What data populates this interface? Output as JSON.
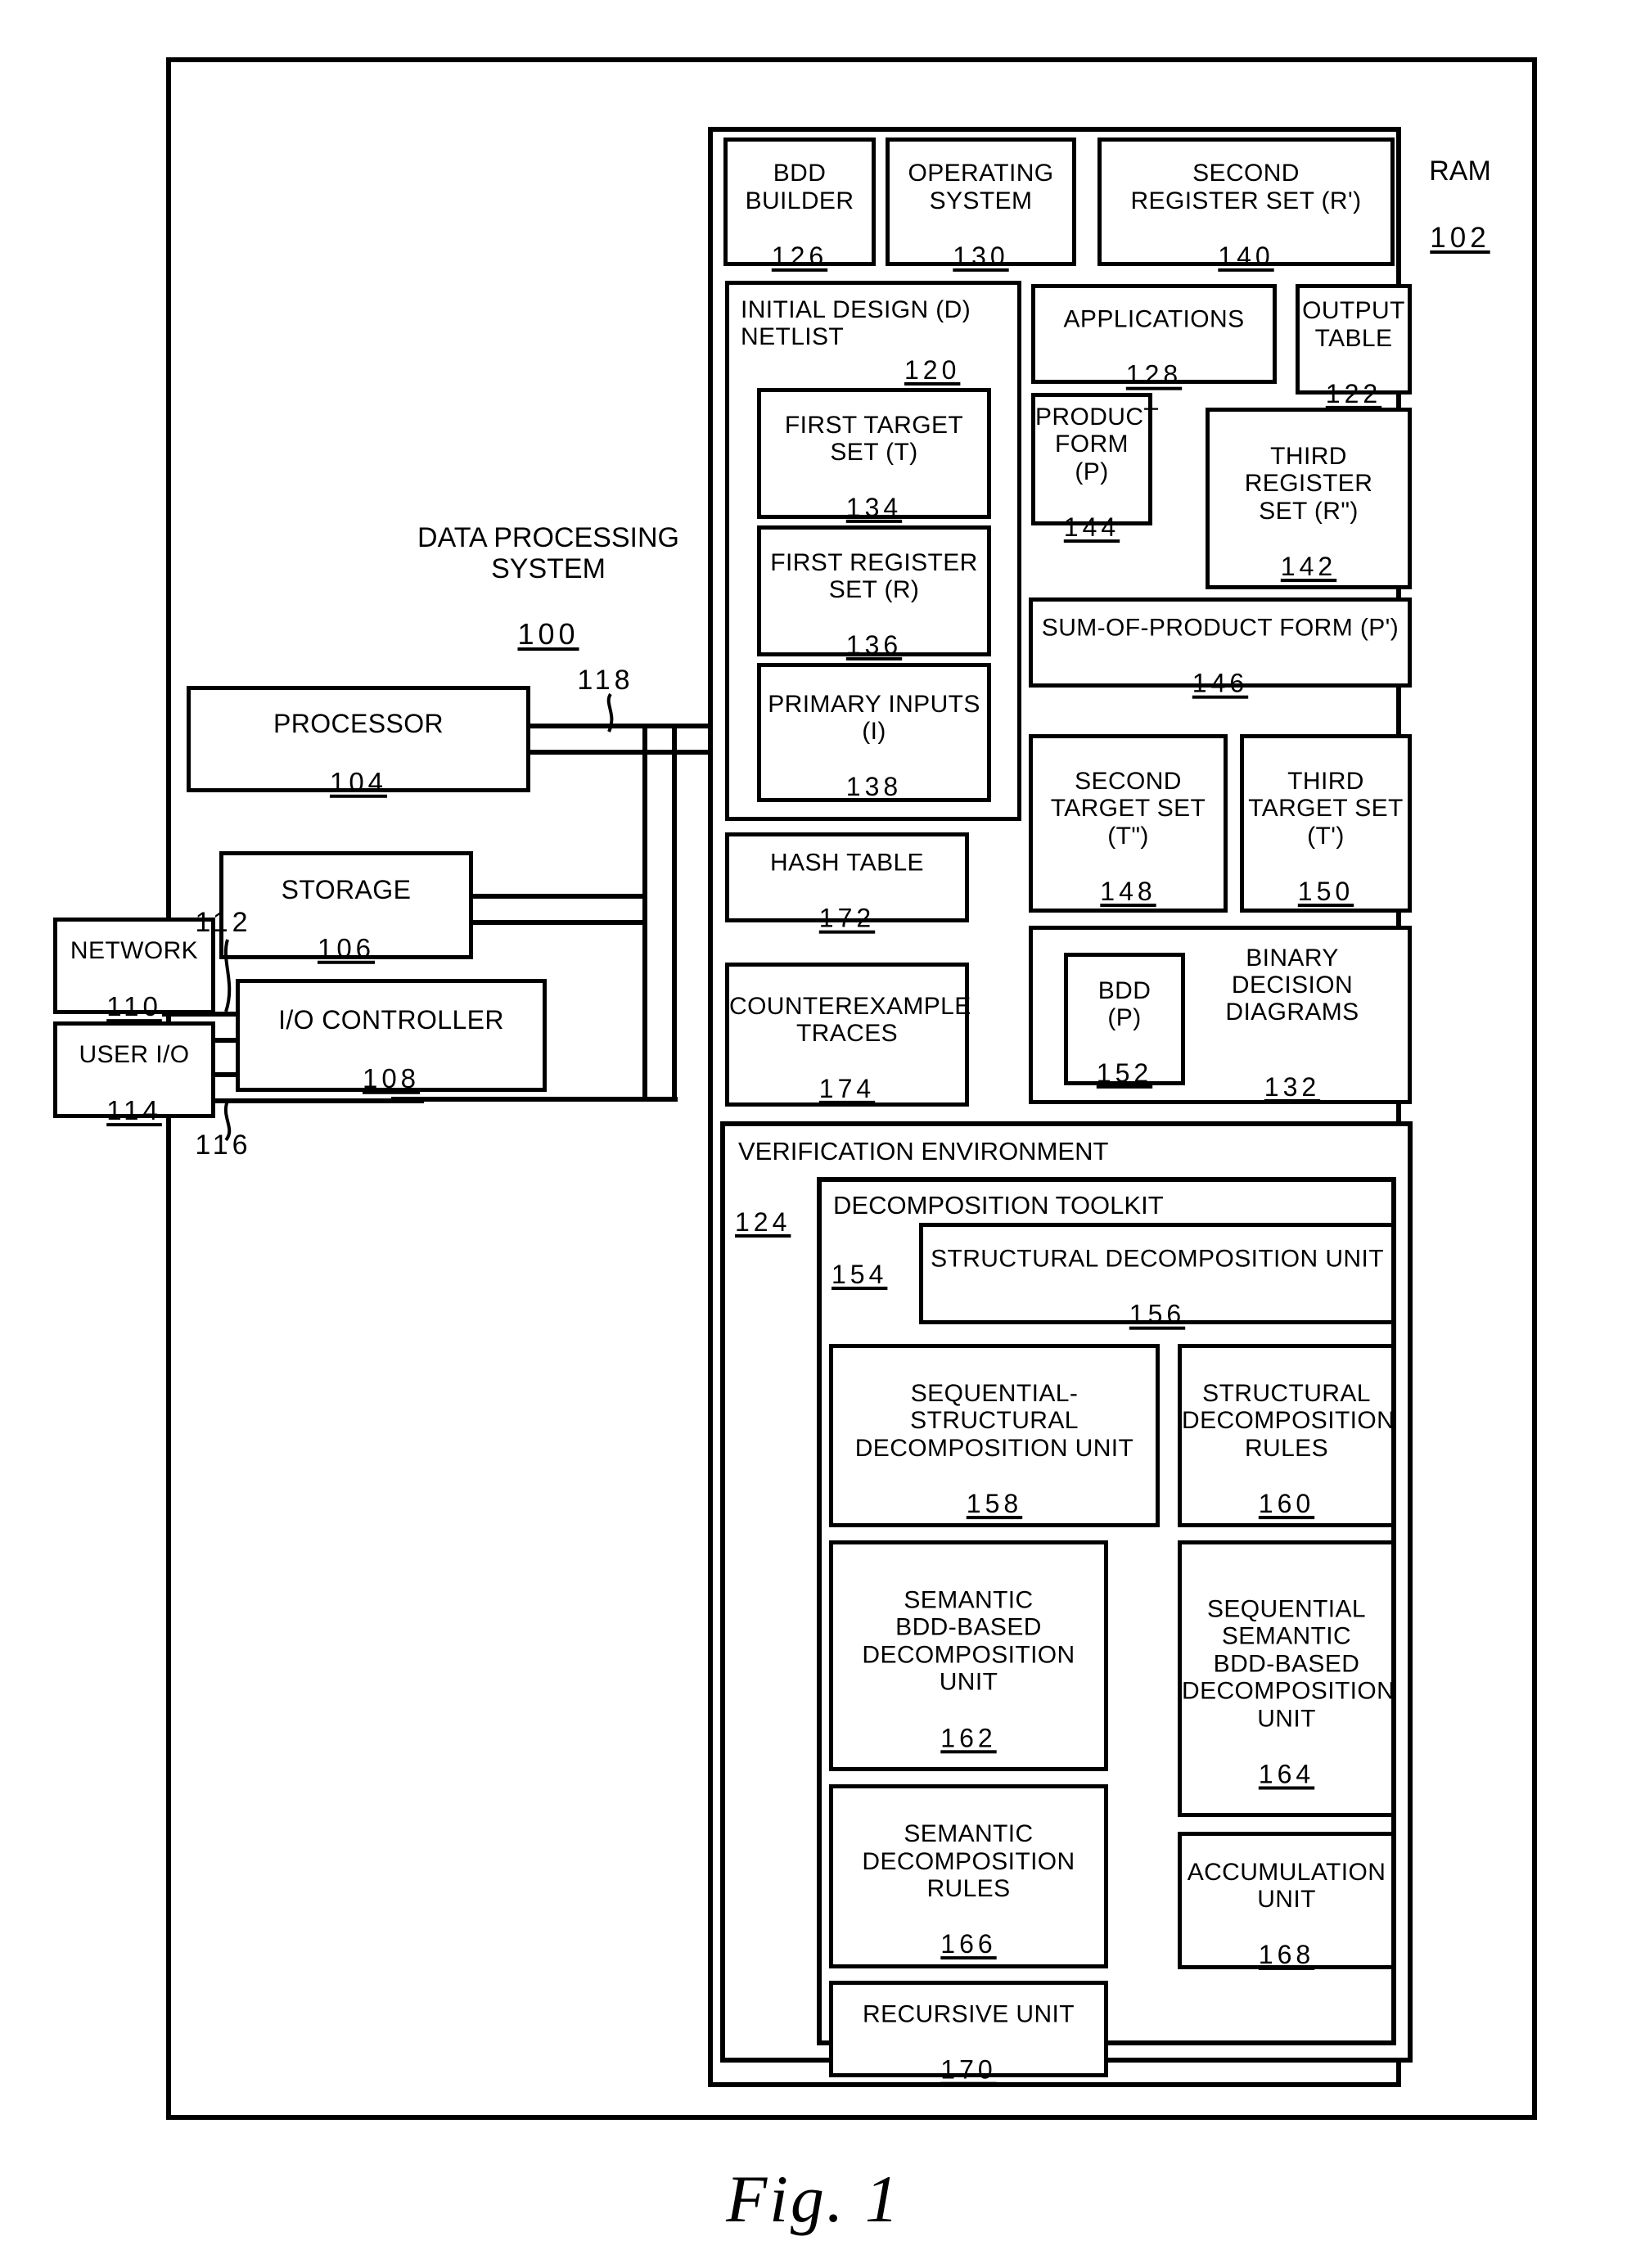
{
  "figure": {
    "caption": "Fig.  1"
  },
  "system": {
    "title": "DATA PROCESSING\nSYSTEM",
    "ref": "100"
  },
  "hardware": {
    "processor": {
      "label": "PROCESSOR",
      "ref": "104"
    },
    "storage": {
      "label": "STORAGE",
      "ref": "106"
    },
    "io_controller": {
      "label": "I/O CONTROLLER",
      "ref": "108"
    },
    "network": {
      "label": "NETWORK",
      "ref": "110"
    },
    "user_io": {
      "label": "USER I/O",
      "ref": "114"
    },
    "bus_118": "118",
    "bus_112": "112",
    "bus_116": "116"
  },
  "ram": {
    "label": "RAM",
    "ref": "102"
  },
  "memory_blocks": {
    "bdd_builder": {
      "label": "BDD\nBUILDER",
      "ref": "126"
    },
    "operating_system": {
      "label": "OPERATING\nSYSTEM",
      "ref": "130"
    },
    "second_register_set": {
      "label": "SECOND\nREGISTER SET (R')",
      "ref": "140"
    },
    "initial_design_netlist": {
      "label": "INITIAL DESIGN (D)\nNETLIST",
      "ref": "120"
    },
    "first_target_set": {
      "label": "FIRST TARGET\nSET (T)",
      "ref": "134"
    },
    "first_register_set": {
      "label": "FIRST REGISTER\nSET (R)",
      "ref": "136"
    },
    "primary_inputs": {
      "label": "PRIMARY INPUTS\n(I)",
      "ref": "138"
    },
    "applications": {
      "label": "APPLICATIONS",
      "ref": "128"
    },
    "output_table": {
      "label": "OUTPUT\nTABLE",
      "ref": "122"
    },
    "product_form": {
      "label": "PRODUCT\nFORM (P)",
      "ref": "144"
    },
    "third_register_set": {
      "label": "THIRD\nREGISTER\nSET (R\")",
      "ref": "142"
    },
    "sum_of_product_form": {
      "label": "SUM-OF-PRODUCT FORM (P')",
      "ref": "146"
    },
    "second_target_set": {
      "label": "SECOND\nTARGET SET\n(T\")",
      "ref": "148"
    },
    "third_target_set": {
      "label": "THIRD\nTARGET SET\n(T')",
      "ref": "150"
    },
    "hash_table": {
      "label": "HASH TABLE",
      "ref": "172"
    },
    "counterexample_traces": {
      "label": "COUNTEREXAMPLE\nTRACES",
      "ref": "174"
    },
    "binary_decision_diagrams": {
      "label": "BINARY\nDECISION\nDIAGRAMS",
      "ref": "132"
    },
    "bdd_p": {
      "label": "BDD\n(P)",
      "ref": "152"
    }
  },
  "verification_environment": {
    "label": "VERIFICATION ENVIRONMENT",
    "ref": "124"
  },
  "decomposition_toolkit": {
    "label": "DECOMPOSITION TOOLKIT",
    "ref": "154",
    "units": {
      "structural_decomposition_unit": {
        "label": "STRUCTURAL DECOMPOSITION UNIT",
        "ref": "156"
      },
      "sequential_structural_decomposition_unit": {
        "label": "SEQUENTIAL-\nSTRUCTURAL\nDECOMPOSITION UNIT",
        "ref": "158"
      },
      "structural_decomposition_rules": {
        "label": "STRUCTURAL\nDECOMPOSITION\nRULES",
        "ref": "160"
      },
      "semantic_bdd_based_decomposition_unit": {
        "label": "SEMANTIC\nBDD-BASED\nDECOMPOSITION\nUNIT",
        "ref": "162"
      },
      "sequential_semantic_bdd_based_decomposition_unit": {
        "label": "SEQUENTIAL\nSEMANTIC\nBDD-BASED\nDECOMPOSITION\nUNIT",
        "ref": "164"
      },
      "semantic_decomposition_rules": {
        "label": "SEMANTIC\nDECOMPOSITION\nRULES",
        "ref": "166"
      },
      "accumulation_unit": {
        "label": "ACCUMULATION\nUNIT",
        "ref": "168"
      },
      "recursive_unit": {
        "label": "RECURSIVE UNIT",
        "ref": "170"
      }
    }
  }
}
